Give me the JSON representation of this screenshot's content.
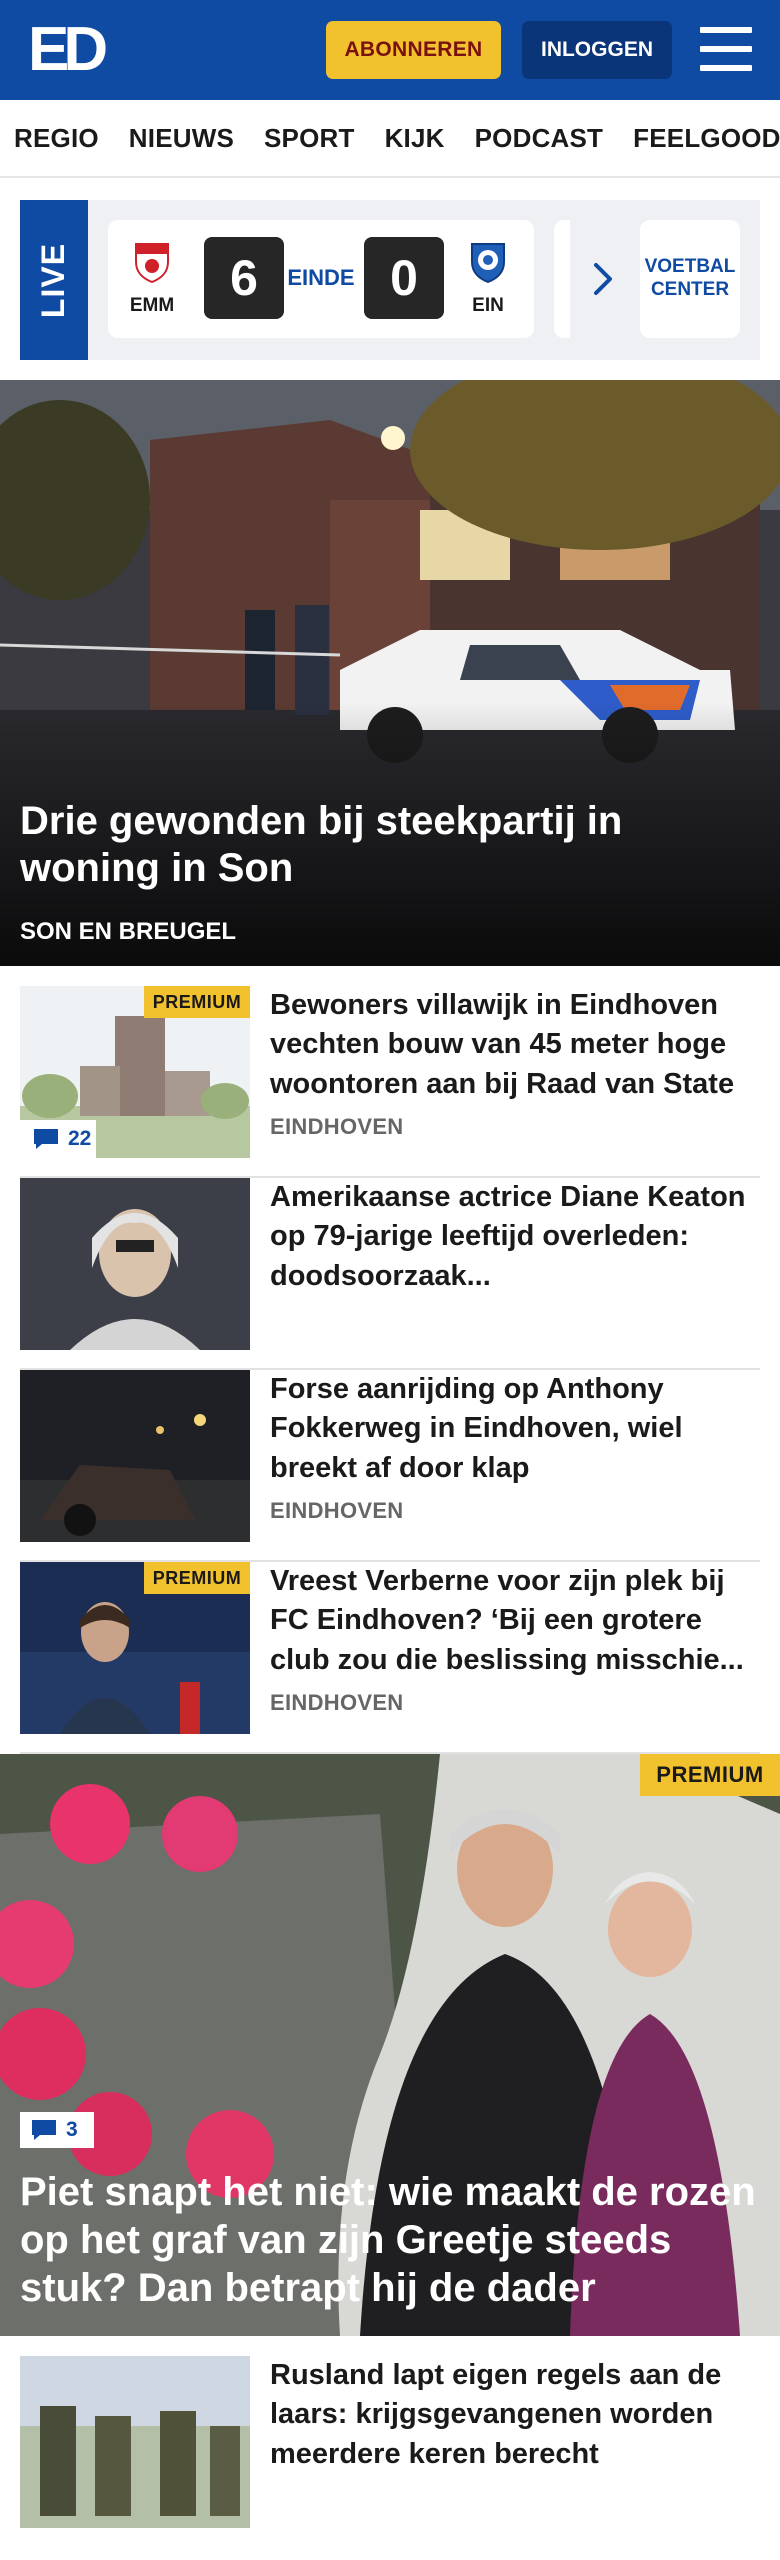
{
  "header": {
    "logo_text": "ED",
    "subscribe_label": "ABONNEREN",
    "login_label": "INLOGGEN",
    "brand_color": "#0f4aa3",
    "accent_color": "#f2c12e"
  },
  "nav": {
    "items": [
      "REGIO",
      "NIEUWS",
      "SPORT",
      "KIJK",
      "PODCAST",
      "FEELGOOD"
    ]
  },
  "live": {
    "label": "LIVE",
    "match": {
      "home_code": "EMM",
      "home_score": "6",
      "status": "EINDE",
      "away_score": "0",
      "away_code": "EIN"
    },
    "center_label": "VOETBAL CENTER"
  },
  "hero": {
    "title": "Drie gewonden bij steekpartij in woning in Son",
    "tag": "SON EN BREUGEL"
  },
  "articles": [
    {
      "title": "Bewoners villawijk in Eindhoven vechten bouw van 45 meter hoge woontoren aan bij Raad van State",
      "tag": "EINDHOVEN",
      "premium": "PREMIUM",
      "comments": "22"
    },
    {
      "title": "Amerikaanse actrice Diane Keaton op 79-jarige leeftijd overleden: doodsoorzaak...",
      "tag": "",
      "premium": "",
      "comments": ""
    },
    {
      "title": "Forse aanrijding op Anthony Fokkerweg in Eindhoven, wiel breekt af door klap",
      "tag": "EINDHOVEN",
      "premium": "",
      "comments": ""
    },
    {
      "title": "Vreest Verberne voor zijn plek bij FC Eindhoven? ‘Bij een grotere club zou die beslissing misschie...",
      "tag": "EINDHOVEN",
      "premium": "PREMIUM",
      "comments": ""
    }
  ],
  "feature": {
    "premium": "PREMIUM",
    "comments": "3",
    "title": "Piet snapt het niet: wie maakt de rozen op het graf van zijn Greetje steeds stuk? Dan betrapt hij de dader"
  },
  "article_after": {
    "title": "Rusland lapt eigen regels aan de laars: krijgsgevangenen worden meerdere keren berecht"
  }
}
